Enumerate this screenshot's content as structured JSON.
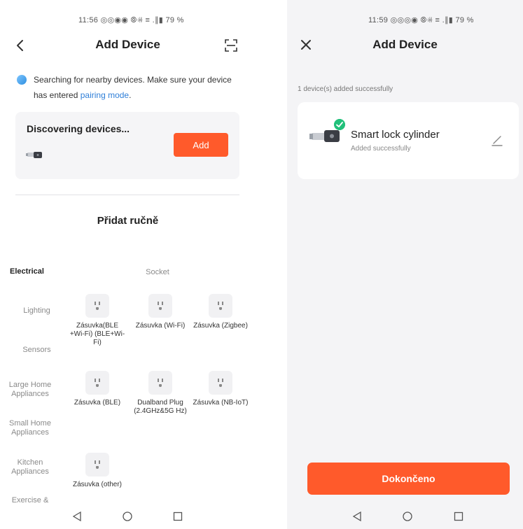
{
  "left": {
    "status_bar": "11:56 ◎◎◉◉  ⦾✳⃒ ≡ .∥▮ 79 %",
    "title": "Add Device",
    "search_text": "Searching for nearby devices. Make sure your device has entered ",
    "pairing_link": "pairing mode",
    "search_suffix": ".",
    "discover_title": "Discovering devices...",
    "add_label": "Add",
    "manual_title": "Přidat ručně",
    "categories": [
      {
        "label": "Electrical",
        "active": true
      },
      {
        "label": "Lighting"
      },
      {
        "label": "Sensors"
      },
      {
        "label": "Large Home Appliances"
      },
      {
        "label": "Small Home Appliances"
      },
      {
        "label": "Kitchen Appliances"
      },
      {
        "label": "Exercise & Health"
      }
    ],
    "section_title": "Socket",
    "tiles": [
      {
        "label": "Zásuvka(BLE +Wi-Fi) (BLE+Wi-Fi)"
      },
      {
        "label": "Zásuvka (Wi-Fi)"
      },
      {
        "label": "Zásuvka (Zigbee)"
      },
      {
        "label": "Zásuvka (BLE)"
      },
      {
        "label": "Dualband Plug (2.4GHz&5G Hz)"
      },
      {
        "label": "Zásuvka (NB-IoT)"
      },
      {
        "label": "Zásuvka (other)"
      }
    ]
  },
  "right": {
    "status_bar": "11:59 ◎◎◎◉  ⦾✳⃒ ≡ .∥▮ 79 %",
    "title": "Add Device",
    "success_count": "1 device(s) added successfully",
    "device_name": "Smart lock cylinder",
    "device_status": "Added successfully",
    "done_label": "Dokončeno"
  },
  "colors": {
    "accent": "#ff5a2b",
    "link": "#2f7fd8",
    "success": "#21c07a"
  },
  "icons": [
    "back-icon",
    "scan-icon",
    "close-icon",
    "edit-icon",
    "check-icon",
    "nav-back-icon",
    "nav-home-icon",
    "nav-recents-icon"
  ]
}
